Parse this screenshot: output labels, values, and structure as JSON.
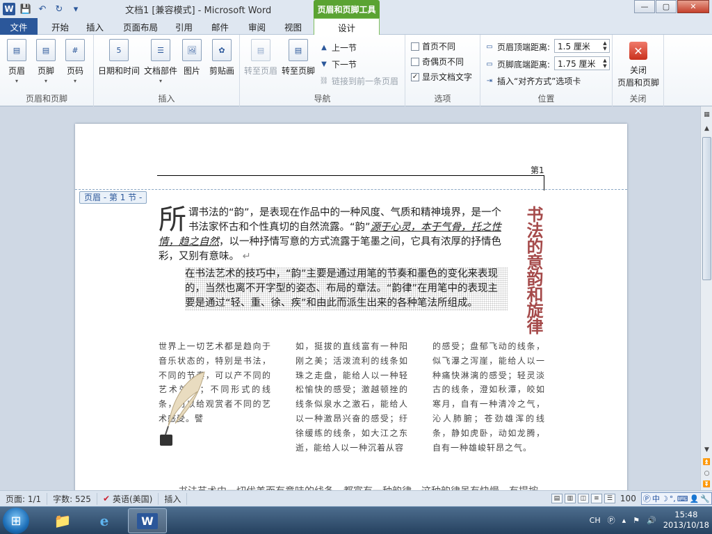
{
  "window": {
    "title": "文档1 [兼容模式] - Microsoft Word",
    "context_tab_title": "页眉和页脚工具",
    "controls": {
      "minimize": "—",
      "maximize": "▢",
      "close": "✕"
    }
  },
  "tabs": [
    {
      "label": "文件"
    },
    {
      "label": "开始"
    },
    {
      "label": "插入"
    },
    {
      "label": "页面布局"
    },
    {
      "label": "引用"
    },
    {
      "label": "邮件"
    },
    {
      "label": "审阅"
    },
    {
      "label": "视图"
    },
    {
      "label": "设计",
      "active": true
    }
  ],
  "ribbon": {
    "groups": {
      "header_footer": {
        "label": "页眉和页脚",
        "header_btn": "页眉",
        "footer_btn": "页脚",
        "page_number_btn": "页码"
      },
      "insert": {
        "label": "插入",
        "datetime_btn": "日期和时间",
        "doc_parts_btn": "文档部件",
        "picture_btn": "图片",
        "clipart_btn": "剪贴画"
      },
      "nav": {
        "label": "导航",
        "goto_header_btn": "转至页眉",
        "goto_footer_btn": "转至页脚",
        "prev_btn": "上一节",
        "next_btn": "下一节",
        "link_prev_btn": "链接到前一条页眉"
      },
      "options": {
        "label": "选项",
        "diff_first": "首页不同",
        "diff_odd_even": "奇偶页不同",
        "show_doc_text": "显示文档文字",
        "show_doc_text_checked": true
      },
      "position": {
        "label": "位置",
        "header_top_label": "页眉顶端距离:",
        "header_top_value": "1.5 厘米",
        "footer_bottom_label": "页脚底端距离:",
        "footer_bottom_value": "1.75 厘米",
        "insert_align_tab": "插入“对齐方式”选项卡"
      },
      "close": {
        "label": "关闭",
        "close_btn_line1": "关闭",
        "close_btn_line2": "页眉和页脚"
      }
    }
  },
  "document": {
    "page_header_text": "第1",
    "header_tag": "页眉 - 第 1 节 -",
    "para1_dropcap": "所",
    "para1_a": "谓书法的“韵”，是表现在作品中的一种风度、气质和精神境界，是一个书法家怀古和个性真切的自然流露。“韵”",
    "para1_underlined": "源于心灵，本于气骨，托之性情，趋之自然",
    "para1_b": "，以一种抒情写意的方式流露于笔墨之间，它具有浓厚的抒情色彩，又别有意味。",
    "para2": "在书法艺术的技巧中，“韵”主要是通过用笔的节奏和墨色的变化来表现的，当然也离不开字型的姿态、布局的章法。“韵律”在用笔中的表现主要是通过“轻、重、徐、疾”和由此而派生出来的各种笔法所组成。",
    "vertical_title": "书法的意韵和旋律",
    "col1": "世界上一切艺术都是趋向于音乐状态的，特别是书法，不同的节奏，可以产不同的艺术效果；不同形式的线条，可以给观赏者不同的艺术感受。譬",
    "col2": "如，挺拔的直线富有一种阳刚之美；活泼流利的线条如珠之走盘，能给人以一种轻松愉快的感受；激越顿挫的线条似泉水之激石，能给人以一种激昂兴奋的感受；纡徐缓练的线条，如大江之东逝，能给人以一种沉着从容",
    "col3": "的感受；盘郁飞动的线条，似飞瀑之泻崖，能给人以一种痛快淋漓的感受；轻灵淡古的线条，澄如秋潭，皎如寒月，自有一种清冷之气，沁人肺腑；苍劲雄浑的线条，静如虎卧，动如龙腾，自有一种雄峻轩昂之气。",
    "last_line": "书法艺术中一切优美而有意味的线条，都富有一种韵律，这种韵律虽有快慢、有提按"
  },
  "statusbar": {
    "page": "页面: 1/1",
    "words": "字数: 525",
    "language": "英语(美国)",
    "insert_mode": "插入",
    "zoom": "100"
  },
  "taskbar": {
    "tray_lang": "CH",
    "time": "15:48",
    "date": "2013/10/18"
  },
  "colors": {
    "word_blue": "#2b579a",
    "context_green": "#5aa332",
    "vertical_title_red": "#a54a4a"
  }
}
